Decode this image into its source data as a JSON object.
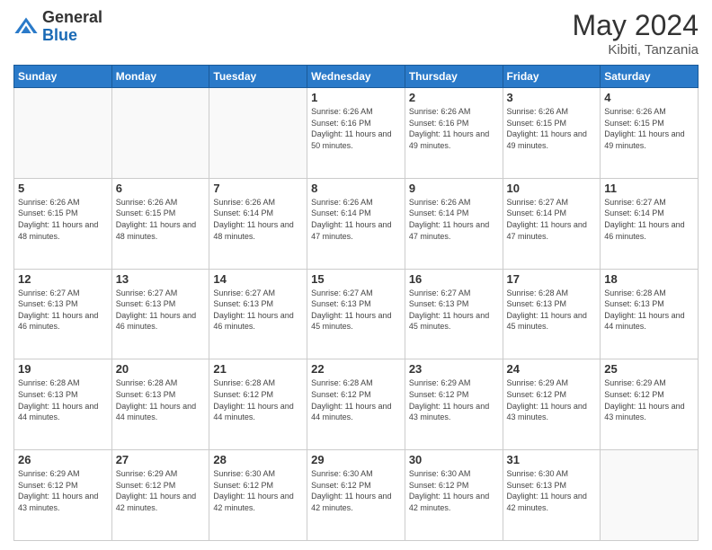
{
  "header": {
    "logo_general": "General",
    "logo_blue": "Blue",
    "month_year": "May 2024",
    "location": "Kibiti, Tanzania"
  },
  "weekdays": [
    "Sunday",
    "Monday",
    "Tuesday",
    "Wednesday",
    "Thursday",
    "Friday",
    "Saturday"
  ],
  "weeks": [
    [
      {
        "day": "",
        "sunrise": "",
        "sunset": "",
        "daylight": "",
        "empty": true
      },
      {
        "day": "",
        "sunrise": "",
        "sunset": "",
        "daylight": "",
        "empty": true
      },
      {
        "day": "",
        "sunrise": "",
        "sunset": "",
        "daylight": "",
        "empty": true
      },
      {
        "day": "1",
        "sunrise": "Sunrise: 6:26 AM",
        "sunset": "Sunset: 6:16 PM",
        "daylight": "Daylight: 11 hours and 50 minutes."
      },
      {
        "day": "2",
        "sunrise": "Sunrise: 6:26 AM",
        "sunset": "Sunset: 6:16 PM",
        "daylight": "Daylight: 11 hours and 49 minutes."
      },
      {
        "day": "3",
        "sunrise": "Sunrise: 6:26 AM",
        "sunset": "Sunset: 6:15 PM",
        "daylight": "Daylight: 11 hours and 49 minutes."
      },
      {
        "day": "4",
        "sunrise": "Sunrise: 6:26 AM",
        "sunset": "Sunset: 6:15 PM",
        "daylight": "Daylight: 11 hours and 49 minutes."
      }
    ],
    [
      {
        "day": "5",
        "sunrise": "Sunrise: 6:26 AM",
        "sunset": "Sunset: 6:15 PM",
        "daylight": "Daylight: 11 hours and 48 minutes."
      },
      {
        "day": "6",
        "sunrise": "Sunrise: 6:26 AM",
        "sunset": "Sunset: 6:15 PM",
        "daylight": "Daylight: 11 hours and 48 minutes."
      },
      {
        "day": "7",
        "sunrise": "Sunrise: 6:26 AM",
        "sunset": "Sunset: 6:14 PM",
        "daylight": "Daylight: 11 hours and 48 minutes."
      },
      {
        "day": "8",
        "sunrise": "Sunrise: 6:26 AM",
        "sunset": "Sunset: 6:14 PM",
        "daylight": "Daylight: 11 hours and 47 minutes."
      },
      {
        "day": "9",
        "sunrise": "Sunrise: 6:26 AM",
        "sunset": "Sunset: 6:14 PM",
        "daylight": "Daylight: 11 hours and 47 minutes."
      },
      {
        "day": "10",
        "sunrise": "Sunrise: 6:27 AM",
        "sunset": "Sunset: 6:14 PM",
        "daylight": "Daylight: 11 hours and 47 minutes."
      },
      {
        "day": "11",
        "sunrise": "Sunrise: 6:27 AM",
        "sunset": "Sunset: 6:14 PM",
        "daylight": "Daylight: 11 hours and 46 minutes."
      }
    ],
    [
      {
        "day": "12",
        "sunrise": "Sunrise: 6:27 AM",
        "sunset": "Sunset: 6:13 PM",
        "daylight": "Daylight: 11 hours and 46 minutes."
      },
      {
        "day": "13",
        "sunrise": "Sunrise: 6:27 AM",
        "sunset": "Sunset: 6:13 PM",
        "daylight": "Daylight: 11 hours and 46 minutes."
      },
      {
        "day": "14",
        "sunrise": "Sunrise: 6:27 AM",
        "sunset": "Sunset: 6:13 PM",
        "daylight": "Daylight: 11 hours and 46 minutes."
      },
      {
        "day": "15",
        "sunrise": "Sunrise: 6:27 AM",
        "sunset": "Sunset: 6:13 PM",
        "daylight": "Daylight: 11 hours and 45 minutes."
      },
      {
        "day": "16",
        "sunrise": "Sunrise: 6:27 AM",
        "sunset": "Sunset: 6:13 PM",
        "daylight": "Daylight: 11 hours and 45 minutes."
      },
      {
        "day": "17",
        "sunrise": "Sunrise: 6:28 AM",
        "sunset": "Sunset: 6:13 PM",
        "daylight": "Daylight: 11 hours and 45 minutes."
      },
      {
        "day": "18",
        "sunrise": "Sunrise: 6:28 AM",
        "sunset": "Sunset: 6:13 PM",
        "daylight": "Daylight: 11 hours and 44 minutes."
      }
    ],
    [
      {
        "day": "19",
        "sunrise": "Sunrise: 6:28 AM",
        "sunset": "Sunset: 6:13 PM",
        "daylight": "Daylight: 11 hours and 44 minutes."
      },
      {
        "day": "20",
        "sunrise": "Sunrise: 6:28 AM",
        "sunset": "Sunset: 6:13 PM",
        "daylight": "Daylight: 11 hours and 44 minutes."
      },
      {
        "day": "21",
        "sunrise": "Sunrise: 6:28 AM",
        "sunset": "Sunset: 6:12 PM",
        "daylight": "Daylight: 11 hours and 44 minutes."
      },
      {
        "day": "22",
        "sunrise": "Sunrise: 6:28 AM",
        "sunset": "Sunset: 6:12 PM",
        "daylight": "Daylight: 11 hours and 44 minutes."
      },
      {
        "day": "23",
        "sunrise": "Sunrise: 6:29 AM",
        "sunset": "Sunset: 6:12 PM",
        "daylight": "Daylight: 11 hours and 43 minutes."
      },
      {
        "day": "24",
        "sunrise": "Sunrise: 6:29 AM",
        "sunset": "Sunset: 6:12 PM",
        "daylight": "Daylight: 11 hours and 43 minutes."
      },
      {
        "day": "25",
        "sunrise": "Sunrise: 6:29 AM",
        "sunset": "Sunset: 6:12 PM",
        "daylight": "Daylight: 11 hours and 43 minutes."
      }
    ],
    [
      {
        "day": "26",
        "sunrise": "Sunrise: 6:29 AM",
        "sunset": "Sunset: 6:12 PM",
        "daylight": "Daylight: 11 hours and 43 minutes."
      },
      {
        "day": "27",
        "sunrise": "Sunrise: 6:29 AM",
        "sunset": "Sunset: 6:12 PM",
        "daylight": "Daylight: 11 hours and 42 minutes."
      },
      {
        "day": "28",
        "sunrise": "Sunrise: 6:30 AM",
        "sunset": "Sunset: 6:12 PM",
        "daylight": "Daylight: 11 hours and 42 minutes."
      },
      {
        "day": "29",
        "sunrise": "Sunrise: 6:30 AM",
        "sunset": "Sunset: 6:12 PM",
        "daylight": "Daylight: 11 hours and 42 minutes."
      },
      {
        "day": "30",
        "sunrise": "Sunrise: 6:30 AM",
        "sunset": "Sunset: 6:12 PM",
        "daylight": "Daylight: 11 hours and 42 minutes."
      },
      {
        "day": "31",
        "sunrise": "Sunrise: 6:30 AM",
        "sunset": "Sunset: 6:13 PM",
        "daylight": "Daylight: 11 hours and 42 minutes."
      },
      {
        "day": "",
        "sunrise": "",
        "sunset": "",
        "daylight": "",
        "empty": true
      }
    ]
  ]
}
